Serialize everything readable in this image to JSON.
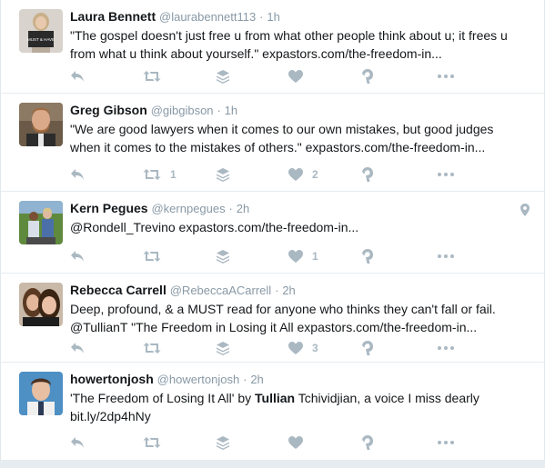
{
  "colors": {
    "icon": "#aab8c2",
    "muted": "#8899a6",
    "text": "#14171a"
  },
  "tweets": [
    {
      "name": "Laura Bennett",
      "handle": "@laurabennett113",
      "sep": "·",
      "time": "1h",
      "line1": "\"The gospel doesn't just free u from what other people think about u; it frees u",
      "line2": "from what u think about yourself.\" expastors.com/the-freedom-in...",
      "avatar_text": "MUST & HAVE",
      "retweets": "",
      "likes": ""
    },
    {
      "name": "Greg Gibson",
      "handle": "@gibgibson",
      "sep": "·",
      "time": "1h",
      "line1": "\"We are good lawyers when it comes to our own mistakes, but good judges",
      "line2": "when it comes to the mistakes of others.\" expastors.com/the-freedom-in...",
      "retweets": "1",
      "likes": "2"
    },
    {
      "name": "Kern Pegues",
      "handle": "@kernpegues",
      "sep": "·",
      "time": "2h",
      "line1": "@Rondell_Trevino expastors.com/the-freedom-in...",
      "retweets": "",
      "likes": "1"
    },
    {
      "name": "Rebecca Carrell",
      "handle": "@RebeccaACarrell",
      "sep": "·",
      "time": "2h",
      "line1": "Deep, profound, & a MUST read for anyone who thinks they can't fall or fail.",
      "line2": "@TullianT \"The Freedom in Losing it All expastors.com/the-freedom-in...",
      "retweets": "",
      "likes": "3"
    },
    {
      "name": "howertonjosh",
      "handle": "@howertonjosh",
      "sep": "·",
      "time": "2h",
      "line1_pre": "'The Freedom of Losing It All' by ",
      "line1_bold": "Tullian",
      "line1_post": " Tchividjian, a voice I miss dearly",
      "line2": "bit.ly/2dp4hNy",
      "retweets": "",
      "likes": ""
    }
  ]
}
